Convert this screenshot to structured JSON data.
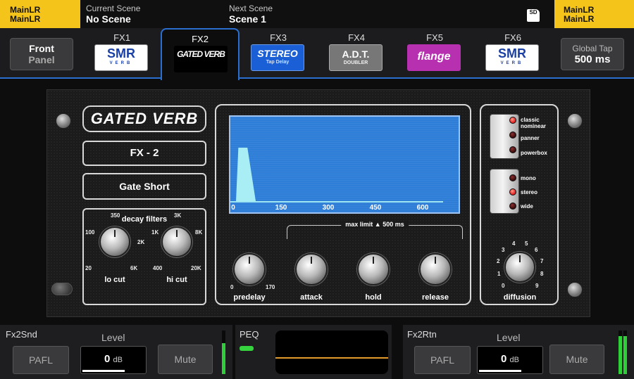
{
  "topbar": {
    "left_badge": {
      "line1": "MainLR",
      "line2": "MainLR"
    },
    "current_scene": {
      "label": "Current Scene",
      "value": "No Scene"
    },
    "next_scene": {
      "label": "Next Scene",
      "value": "Scene 1"
    },
    "sd_icon": {
      "icon": "sd-card-icon",
      "text": "SD"
    },
    "right_badge": {
      "line1": "MainLR",
      "line2": "MainLR"
    }
  },
  "tabs": {
    "front_panel": {
      "line1": "Front",
      "line2": "Panel"
    },
    "global_tap": {
      "label": "Global Tap",
      "value": "500 ms"
    },
    "fx": [
      {
        "name": "FX1",
        "logo": "SMR",
        "logo_sub": "VERB"
      },
      {
        "name": "FX2",
        "logo": "GATED VERB",
        "logo_sub": ""
      },
      {
        "name": "FX3",
        "logo": "STEREO",
        "logo_sub": "Tap Delay"
      },
      {
        "name": "FX4",
        "logo": "A.D.T.",
        "logo_sub": "DOUBLER"
      },
      {
        "name": "FX5",
        "logo": "flange",
        "logo_sub": ""
      },
      {
        "name": "FX6",
        "logo": "SMR",
        "logo_sub": "VERB"
      }
    ],
    "active_index": 1
  },
  "panel": {
    "title": "GATED VERB",
    "fx_label": "FX - 2",
    "preset": "Gate Short",
    "filters": {
      "caption": "decay filters",
      "lo_cut": {
        "label": "lo cut",
        "scale": [
          "20",
          "100",
          "350",
          "1K",
          "6K"
        ]
      },
      "hi_cut": {
        "label": "hi cut",
        "scale": [
          "400",
          "2K",
          "3K",
          "8K",
          "20K"
        ]
      }
    },
    "envelope": {
      "ticks": [
        "0",
        "150",
        "300",
        "450",
        "600"
      ],
      "max_limit": "max limit",
      "max_limit_value": "500 ms",
      "warning_icon": "warning-triangle-icon"
    },
    "knobs": {
      "predelay": {
        "label": "predelay",
        "min": "0",
        "max": "170"
      },
      "attack": {
        "label": "attack"
      },
      "hold": {
        "label": "hold"
      },
      "release": {
        "label": "release"
      },
      "diffusion": {
        "label": "diffusion",
        "scale": [
          "0",
          "1",
          "2",
          "3",
          "4",
          "5",
          "6",
          "7",
          "8",
          "9"
        ]
      }
    },
    "mode_switch": {
      "options": [
        "classic nominear",
        "panner",
        "powerbox"
      ],
      "active": 0
    },
    "width_switch": {
      "options": [
        "mono",
        "stereo",
        "wide"
      ],
      "active": 1
    }
  },
  "bottom": {
    "send": {
      "name": "Fx2Snd",
      "level_label": "Level",
      "pafl": "PAFL",
      "value": "0",
      "unit": "dB",
      "mute": "Mute"
    },
    "peq": {
      "label": "PEQ"
    },
    "return": {
      "name": "Fx2Rtn",
      "level_label": "Level",
      "pafl": "PAFL",
      "value": "0",
      "unit": "dB",
      "mute": "Mute"
    }
  },
  "colors": {
    "accent": "#2a6fd0",
    "badge": "#f4c41b",
    "screen": "#2e7ed8",
    "led_on": "#e01b1b",
    "meter": "#2fcf3a",
    "peq_curve": "#e39a2a"
  }
}
